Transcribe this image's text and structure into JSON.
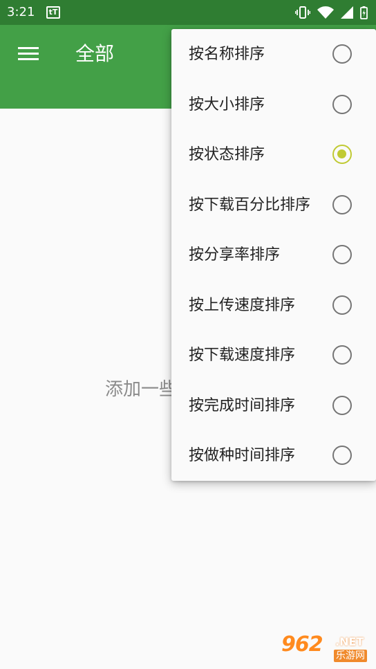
{
  "status_bar": {
    "time": "3:21",
    "app_icon_text": "tT",
    "icons": [
      "vibrate-icon",
      "wifi-icon",
      "signal-icon",
      "battery-icon"
    ]
  },
  "app_bar": {
    "menu_icon": "hamburger-menu-icon",
    "title": "全部"
  },
  "main": {
    "empty_hint": "添加一些"
  },
  "sort_menu": {
    "selected_index": 2,
    "items": [
      {
        "label": "按名称排序",
        "checked": false
      },
      {
        "label": "按大小排序",
        "checked": false
      },
      {
        "label": "按状态排序",
        "checked": true
      },
      {
        "label": "按下载百分比排序",
        "checked": false
      },
      {
        "label": "按分享率排序",
        "checked": false
      },
      {
        "label": "按上传速度排序",
        "checked": false
      },
      {
        "label": "按下载速度排序",
        "checked": false
      },
      {
        "label": "按完成时间排序",
        "checked": false
      },
      {
        "label": "按做种时间排序",
        "checked": false
      }
    ]
  },
  "watermark": {
    "number": "962",
    "domain": ".NET",
    "site_name": "乐游网"
  },
  "colors": {
    "status_bar": "#2f7d32",
    "app_bar": "#43a047",
    "radio_checked": "#c0ca33",
    "radio_unchecked": "#757575"
  }
}
